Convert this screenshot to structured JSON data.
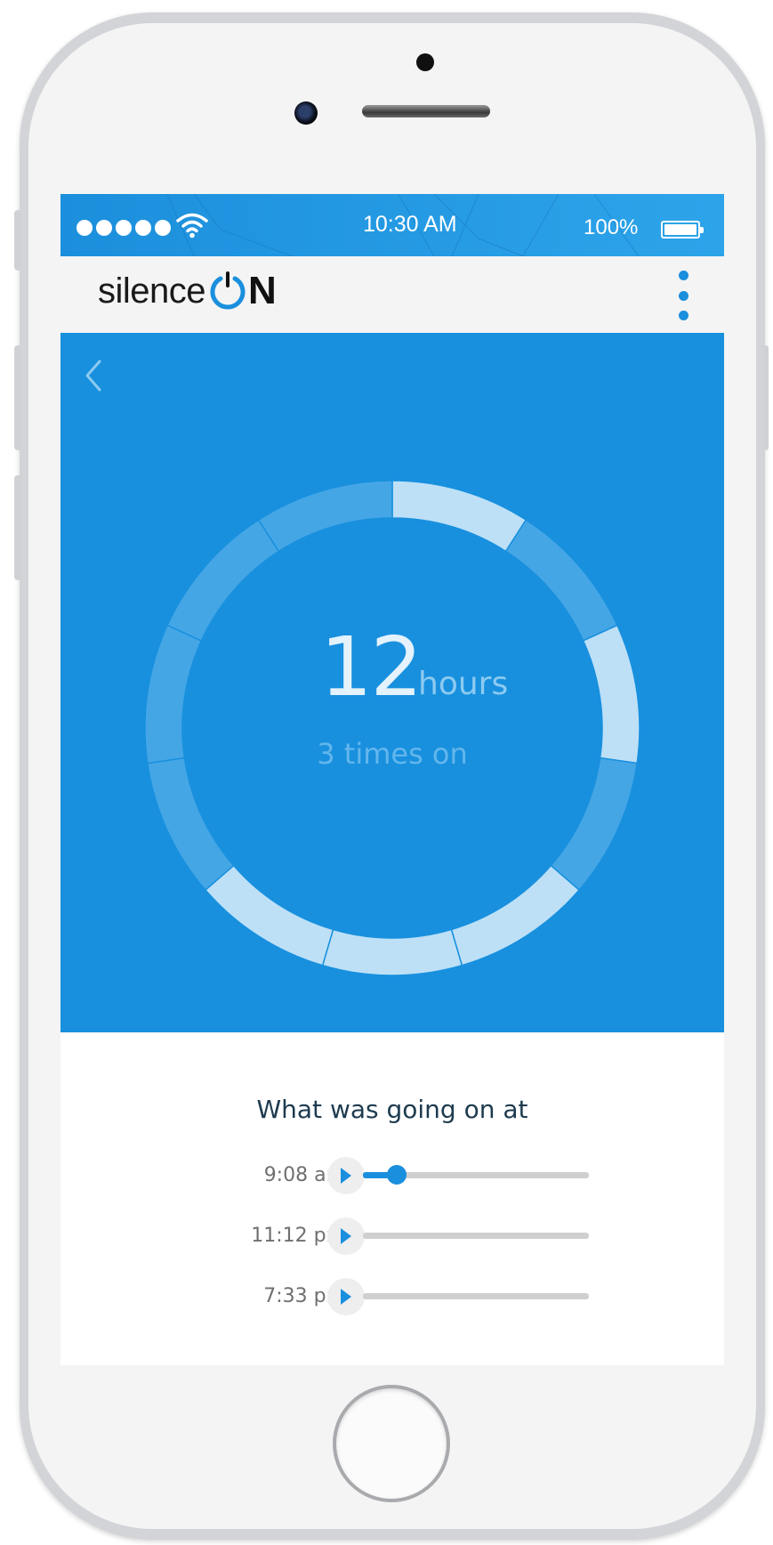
{
  "status_bar": {
    "time": "10:30 AM",
    "battery_percent": "100%",
    "signal_dots": 5,
    "battery_level": 1.0
  },
  "header": {
    "logo_text": "silence",
    "logo_suffix": "N",
    "menu_icon": "more-vertical-icon"
  },
  "hero": {
    "back_icon": "chevron-left-icon",
    "hours_value": "12",
    "hours_unit": "hours",
    "times_on": "3 times on",
    "ring_segments": [
      {
        "active": true
      },
      {
        "active": false
      },
      {
        "active": true
      },
      {
        "active": false
      },
      {
        "active": true
      },
      {
        "active": true
      },
      {
        "active": true
      },
      {
        "active": false
      },
      {
        "active": false
      },
      {
        "active": false
      },
      {
        "active": false
      }
    ]
  },
  "timeline": {
    "title": "What was going on at",
    "items": [
      {
        "time": "9:08 am",
        "progress": 0.15,
        "has_thumb": true
      },
      {
        "time": "11:12 pm",
        "progress": 0,
        "has_thumb": false
      },
      {
        "time": "7:33 pm",
        "progress": 0,
        "has_thumb": false
      }
    ]
  },
  "colors": {
    "brand_blue": "#1890de",
    "accent": "#1a8fdd",
    "ring_active": "#bde0f7",
    "ring_inactive": "#45a6e6"
  }
}
